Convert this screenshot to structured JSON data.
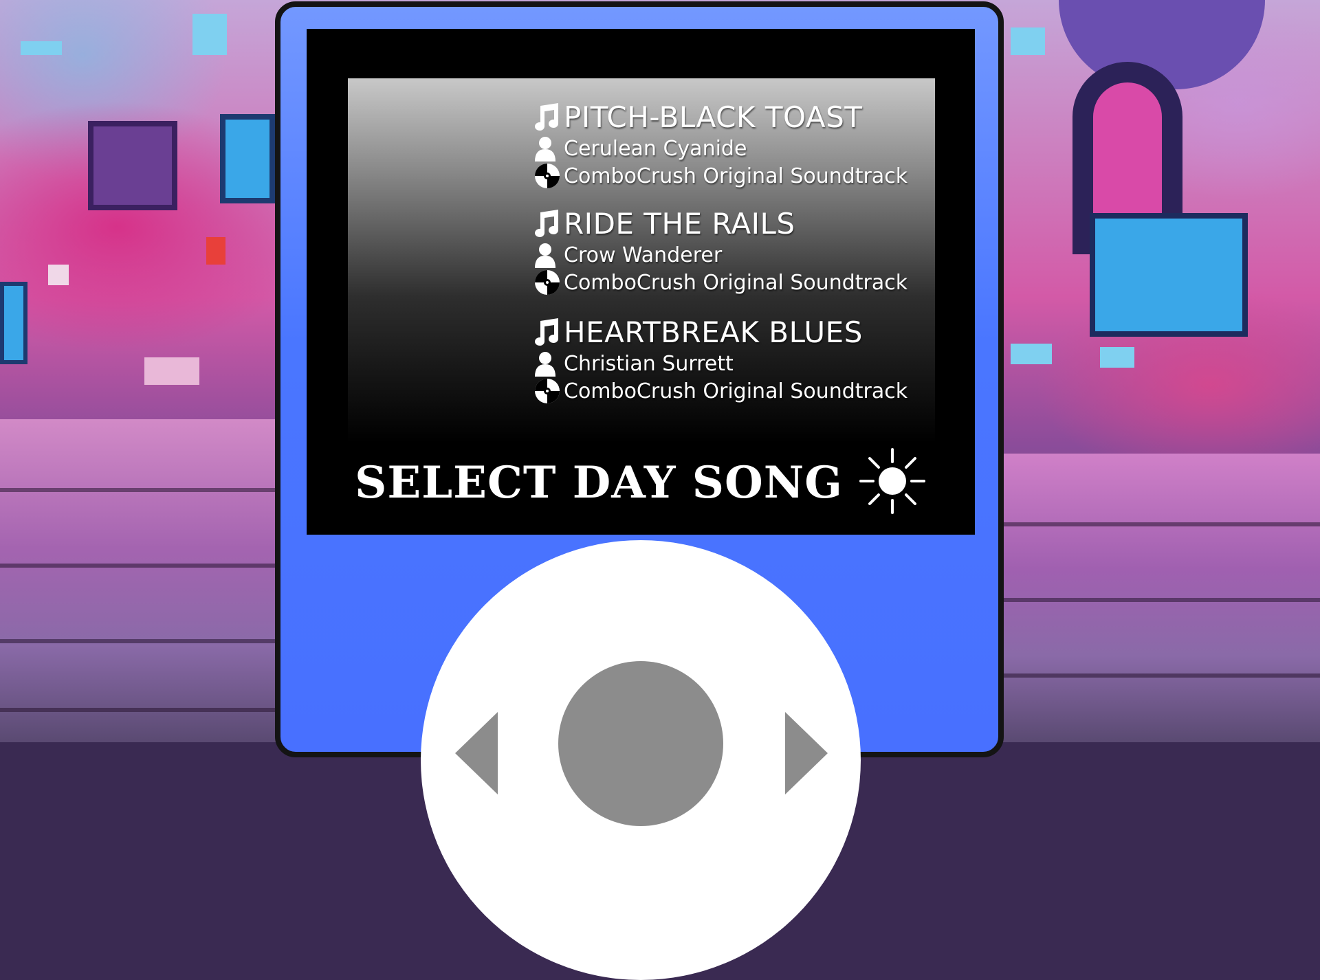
{
  "screen": {
    "songs": [
      {
        "title": "PITCH-BLACK TOAST",
        "artist": "Cerulean Cyanide",
        "album": "ComboCrush Original Soundtrack"
      },
      {
        "title": "RIDE THE RAILS",
        "artist": "Crow Wanderer",
        "album": "ComboCrush Original Soundtrack"
      },
      {
        "title": "HEARTBREAK BLUES",
        "artist": "Christian Surrett",
        "album": "ComboCrush Original Soundtrack"
      }
    ],
    "footer_label": "SELECT DAY SONG"
  },
  "icons": {
    "title": "music-note-icon",
    "artist": "person-icon",
    "album": "disc-icon",
    "footer": "sun-icon"
  },
  "colors": {
    "player_body": "#4a76ff",
    "screen_bg": "#000000",
    "wheel": "#ffffff",
    "wheel_controls": "#8c8c8c"
  }
}
